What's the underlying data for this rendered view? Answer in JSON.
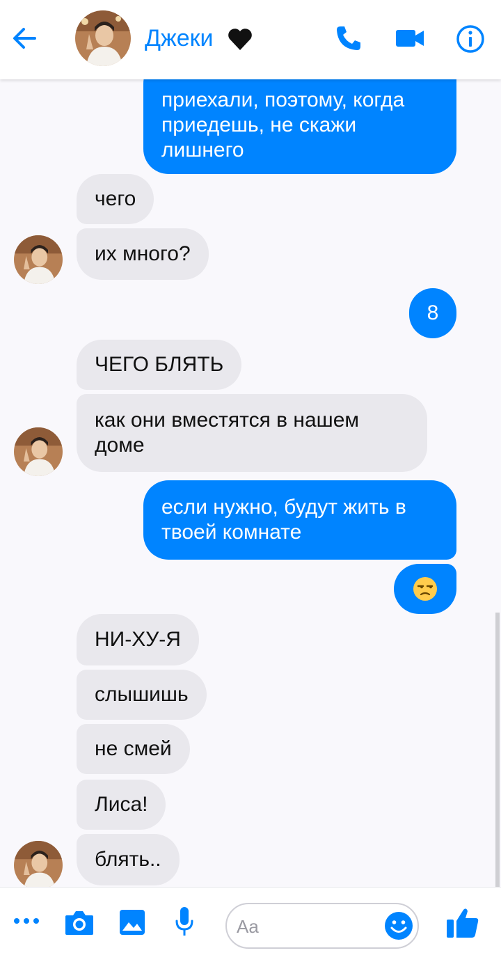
{
  "header": {
    "contact_name": "Джеки",
    "accent": "#0084ff"
  },
  "messages": [
    {
      "side": "out",
      "text": "приехали, поэтому, когда приедешь, не скажи лишнего"
    },
    {
      "side": "in",
      "text": "чего"
    },
    {
      "side": "in",
      "text": "их много?"
    },
    {
      "side": "out",
      "text": "8"
    },
    {
      "side": "in",
      "text": "ЧЕГО БЛЯТЬ"
    },
    {
      "side": "in",
      "text": "как они вместятся в нашем доме"
    },
    {
      "side": "out",
      "text": "если нужно, будут жить в твоей комнате"
    },
    {
      "side": "out",
      "emoji": "unamused-face"
    },
    {
      "side": "in",
      "text": "НИ-ХУ-Я"
    },
    {
      "side": "in",
      "text": "слышишь"
    },
    {
      "side": "in",
      "text": "не смей"
    },
    {
      "side": "in",
      "text": "Лиса!"
    },
    {
      "side": "in",
      "text": "блять.."
    }
  ],
  "composer": {
    "placeholder": "Aa"
  },
  "icons": {
    "header": [
      "back-arrow-icon",
      "heart-icon",
      "phone-icon",
      "video-camera-icon",
      "info-icon"
    ],
    "composer": [
      "more-icon",
      "camera-icon",
      "gallery-icon",
      "microphone-icon",
      "emoji-icon",
      "thumbs-up-icon"
    ]
  }
}
